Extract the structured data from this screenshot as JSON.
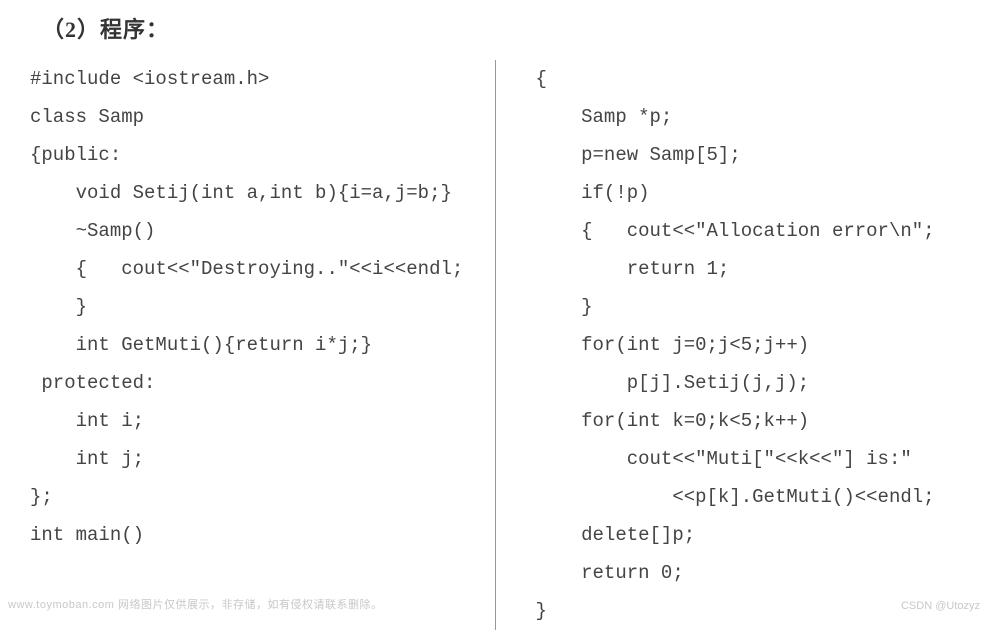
{
  "heading": "（2）程序：",
  "left_code": [
    "#include <iostream.h>",
    "class Samp",
    "{public:",
    "    void Setij(int a,int b){i=a,j=b;}",
    "    ~Samp()",
    "    {   cout<<\"Destroying..\"<<i<<endl;",
    "    }",
    "    int GetMuti(){return i*j;}",
    " protected:",
    "    int i;",
    "    int j;",
    "};",
    "",
    "",
    "int main()"
  ],
  "right_code": [
    "{",
    "    Samp *p;",
    "    p=new Samp[5];",
    "    if(!p)",
    "    {   cout<<\"Allocation error\\n\";",
    "        return 1;",
    "    }",
    "    for(int j=0;j<5;j++)",
    "        p[j].Setij(j,j);",
    "    for(int k=0;k<5;k++)",
    "        cout<<\"Muti[\"<<k<<\"] is:\"",
    "            <<p[k].GetMuti()<<endl;",
    "    delete[]p;",
    "    return 0;",
    "}"
  ],
  "watermark_left": "www.toymoban.com 网络图片仅供展示，非存储，如有侵权请联系删除。",
  "watermark_right": "CSDN @Utozyz"
}
